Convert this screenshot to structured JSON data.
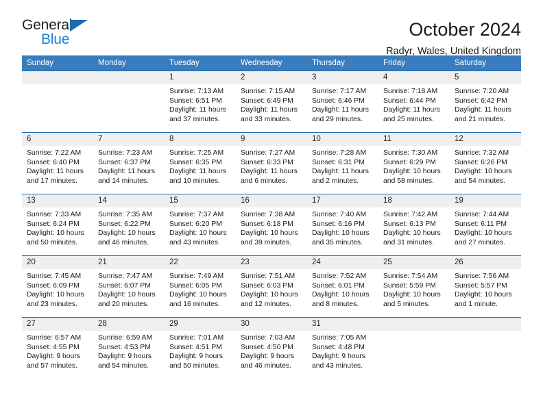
{
  "brand": {
    "name_part1": "General",
    "name_part2": "Blue",
    "triangle_color": "#1b6cb0",
    "blue_color": "#1b7fd4"
  },
  "header": {
    "title": "October 2024",
    "location": "Radyr, Wales, United Kingdom"
  },
  "theme": {
    "header_row_bg": "#3a7dbf",
    "week_divider": "#1b6cb0",
    "daynum_strip_bg": "#efefef"
  },
  "calendar": {
    "weekday_headers": [
      "Sunday",
      "Monday",
      "Tuesday",
      "Wednesday",
      "Thursday",
      "Friday",
      "Saturday"
    ],
    "weeks": [
      [
        {
          "day": "",
          "empty": true,
          "lines": []
        },
        {
          "day": "",
          "empty": true,
          "lines": []
        },
        {
          "day": "1",
          "empty": false,
          "lines": [
            "Sunrise: 7:13 AM",
            "Sunset: 6:51 PM",
            "Daylight: 11 hours",
            "and 37 minutes."
          ]
        },
        {
          "day": "2",
          "empty": false,
          "lines": [
            "Sunrise: 7:15 AM",
            "Sunset: 6:49 PM",
            "Daylight: 11 hours",
            "and 33 minutes."
          ]
        },
        {
          "day": "3",
          "empty": false,
          "lines": [
            "Sunrise: 7:17 AM",
            "Sunset: 6:46 PM",
            "Daylight: 11 hours",
            "and 29 minutes."
          ]
        },
        {
          "day": "4",
          "empty": false,
          "lines": [
            "Sunrise: 7:18 AM",
            "Sunset: 6:44 PM",
            "Daylight: 11 hours",
            "and 25 minutes."
          ]
        },
        {
          "day": "5",
          "empty": false,
          "lines": [
            "Sunrise: 7:20 AM",
            "Sunset: 6:42 PM",
            "Daylight: 11 hours",
            "and 21 minutes."
          ]
        }
      ],
      [
        {
          "day": "6",
          "empty": false,
          "lines": [
            "Sunrise: 7:22 AM",
            "Sunset: 6:40 PM",
            "Daylight: 11 hours",
            "and 17 minutes."
          ]
        },
        {
          "day": "7",
          "empty": false,
          "lines": [
            "Sunrise: 7:23 AM",
            "Sunset: 6:37 PM",
            "Daylight: 11 hours",
            "and 14 minutes."
          ]
        },
        {
          "day": "8",
          "empty": false,
          "lines": [
            "Sunrise: 7:25 AM",
            "Sunset: 6:35 PM",
            "Daylight: 11 hours",
            "and 10 minutes."
          ]
        },
        {
          "day": "9",
          "empty": false,
          "lines": [
            "Sunrise: 7:27 AM",
            "Sunset: 6:33 PM",
            "Daylight: 11 hours",
            "and 6 minutes."
          ]
        },
        {
          "day": "10",
          "empty": false,
          "lines": [
            "Sunrise: 7:28 AM",
            "Sunset: 6:31 PM",
            "Daylight: 11 hours",
            "and 2 minutes."
          ]
        },
        {
          "day": "11",
          "empty": false,
          "lines": [
            "Sunrise: 7:30 AM",
            "Sunset: 6:29 PM",
            "Daylight: 10 hours",
            "and 58 minutes."
          ]
        },
        {
          "day": "12",
          "empty": false,
          "lines": [
            "Sunrise: 7:32 AM",
            "Sunset: 6:26 PM",
            "Daylight: 10 hours",
            "and 54 minutes."
          ]
        }
      ],
      [
        {
          "day": "13",
          "empty": false,
          "lines": [
            "Sunrise: 7:33 AM",
            "Sunset: 6:24 PM",
            "Daylight: 10 hours",
            "and 50 minutes."
          ]
        },
        {
          "day": "14",
          "empty": false,
          "lines": [
            "Sunrise: 7:35 AM",
            "Sunset: 6:22 PM",
            "Daylight: 10 hours",
            "and 46 minutes."
          ]
        },
        {
          "day": "15",
          "empty": false,
          "lines": [
            "Sunrise: 7:37 AM",
            "Sunset: 6:20 PM",
            "Daylight: 10 hours",
            "and 43 minutes."
          ]
        },
        {
          "day": "16",
          "empty": false,
          "lines": [
            "Sunrise: 7:38 AM",
            "Sunset: 6:18 PM",
            "Daylight: 10 hours",
            "and 39 minutes."
          ]
        },
        {
          "day": "17",
          "empty": false,
          "lines": [
            "Sunrise: 7:40 AM",
            "Sunset: 6:16 PM",
            "Daylight: 10 hours",
            "and 35 minutes."
          ]
        },
        {
          "day": "18",
          "empty": false,
          "lines": [
            "Sunrise: 7:42 AM",
            "Sunset: 6:13 PM",
            "Daylight: 10 hours",
            "and 31 minutes."
          ]
        },
        {
          "day": "19",
          "empty": false,
          "lines": [
            "Sunrise: 7:44 AM",
            "Sunset: 6:11 PM",
            "Daylight: 10 hours",
            "and 27 minutes."
          ]
        }
      ],
      [
        {
          "day": "20",
          "empty": false,
          "lines": [
            "Sunrise: 7:45 AM",
            "Sunset: 6:09 PM",
            "Daylight: 10 hours",
            "and 23 minutes."
          ]
        },
        {
          "day": "21",
          "empty": false,
          "lines": [
            "Sunrise: 7:47 AM",
            "Sunset: 6:07 PM",
            "Daylight: 10 hours",
            "and 20 minutes."
          ]
        },
        {
          "day": "22",
          "empty": false,
          "lines": [
            "Sunrise: 7:49 AM",
            "Sunset: 6:05 PM",
            "Daylight: 10 hours",
            "and 16 minutes."
          ]
        },
        {
          "day": "23",
          "empty": false,
          "lines": [
            "Sunrise: 7:51 AM",
            "Sunset: 6:03 PM",
            "Daylight: 10 hours",
            "and 12 minutes."
          ]
        },
        {
          "day": "24",
          "empty": false,
          "lines": [
            "Sunrise: 7:52 AM",
            "Sunset: 6:01 PM",
            "Daylight: 10 hours",
            "and 8 minutes."
          ]
        },
        {
          "day": "25",
          "empty": false,
          "lines": [
            "Sunrise: 7:54 AM",
            "Sunset: 5:59 PM",
            "Daylight: 10 hours",
            "and 5 minutes."
          ]
        },
        {
          "day": "26",
          "empty": false,
          "lines": [
            "Sunrise: 7:56 AM",
            "Sunset: 5:57 PM",
            "Daylight: 10 hours",
            "and 1 minute."
          ]
        }
      ],
      [
        {
          "day": "27",
          "empty": false,
          "lines": [
            "Sunrise: 6:57 AM",
            "Sunset: 4:55 PM",
            "Daylight: 9 hours",
            "and 57 minutes."
          ]
        },
        {
          "day": "28",
          "empty": false,
          "lines": [
            "Sunrise: 6:59 AM",
            "Sunset: 4:53 PM",
            "Daylight: 9 hours",
            "and 54 minutes."
          ]
        },
        {
          "day": "29",
          "empty": false,
          "lines": [
            "Sunrise: 7:01 AM",
            "Sunset: 4:51 PM",
            "Daylight: 9 hours",
            "and 50 minutes."
          ]
        },
        {
          "day": "30",
          "empty": false,
          "lines": [
            "Sunrise: 7:03 AM",
            "Sunset: 4:50 PM",
            "Daylight: 9 hours",
            "and 46 minutes."
          ]
        },
        {
          "day": "31",
          "empty": false,
          "lines": [
            "Sunrise: 7:05 AM",
            "Sunset: 4:48 PM",
            "Daylight: 9 hours",
            "and 43 minutes."
          ]
        },
        {
          "day": "",
          "empty": true,
          "lines": []
        },
        {
          "day": "",
          "empty": true,
          "lines": []
        }
      ]
    ]
  }
}
